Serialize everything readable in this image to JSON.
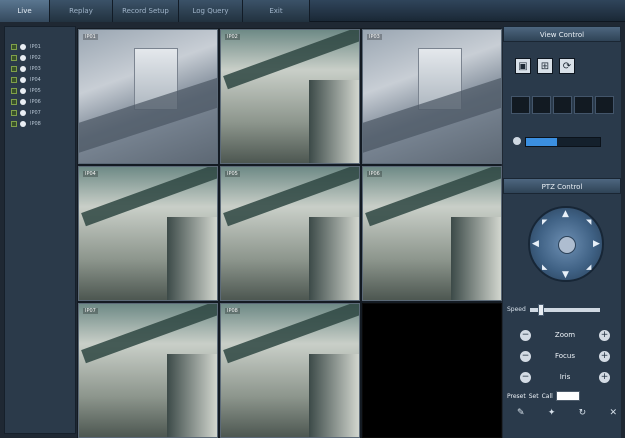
{
  "tabs": [
    {
      "label": "Live"
    },
    {
      "label": "Replay"
    },
    {
      "label": "Record Setup"
    },
    {
      "label": "Log Query"
    },
    {
      "label": "Exit"
    }
  ],
  "camera_list": [
    {
      "label": "IP01"
    },
    {
      "label": "IP02"
    },
    {
      "label": "IP03"
    },
    {
      "label": "IP04"
    },
    {
      "label": "IP05"
    },
    {
      "label": "IP06"
    },
    {
      "label": "IP07"
    },
    {
      "label": "IP08"
    }
  ],
  "video_grid": {
    "cells": [
      {
        "osd": "IP01",
        "scene": "overview"
      },
      {
        "osd": "IP02",
        "scene": "corridor"
      },
      {
        "osd": "IP03",
        "scene": "overview"
      },
      {
        "osd": "IP04",
        "scene": "corridor"
      },
      {
        "osd": "IP05",
        "scene": "corridor"
      },
      {
        "osd": "IP06",
        "scene": "corridor"
      },
      {
        "osd": "IP07",
        "scene": "corridor"
      },
      {
        "osd": "IP08",
        "scene": "corridor"
      },
      {
        "osd": "",
        "scene": "empty"
      }
    ]
  },
  "view_control": {
    "title": "View Control",
    "volume_fraction": 0.42
  },
  "ptz_control": {
    "title": "PTZ Control",
    "speed_label": "Speed",
    "speed_fraction": 0.12,
    "zoom_label": "Zoom",
    "focus_label": "Focus",
    "iris_label": "Iris",
    "preset_label": "Preset",
    "preset_set_label": "Set",
    "preset_go_label": "Call",
    "preset_value": ""
  },
  "colors": {
    "accent": "#3b8fe0",
    "panel": "#2a3a4b",
    "background": "#1f2833"
  }
}
